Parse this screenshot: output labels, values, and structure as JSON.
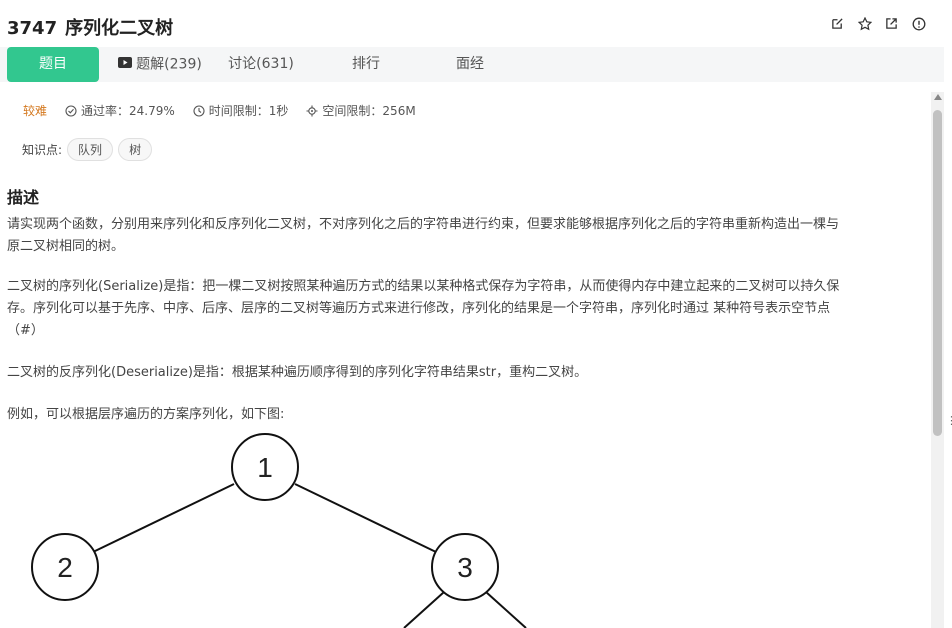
{
  "problem": {
    "number": "3747",
    "title": "序列化二叉树"
  },
  "header_icons": [
    "edit-icon",
    "star-icon",
    "external-link-icon",
    "info-icon"
  ],
  "tabs": [
    {
      "label": "题目",
      "active": true
    },
    {
      "label": "题解(239)",
      "icon": "video-icon"
    },
    {
      "label": "讨论(631)"
    },
    {
      "label": "排行"
    },
    {
      "label": "面经"
    }
  ],
  "meta": {
    "difficulty": "较难",
    "pass_rate": "通过率：24.79%",
    "time_limit": "时间限制：1秒",
    "space_limit": "空间限制：256M"
  },
  "knowledge": {
    "label": "知识点:",
    "tags": [
      "队列",
      "树"
    ]
  },
  "description": {
    "heading": "描述",
    "p1_line1": "请实现两个函数，分别用来序列化和反序列化二叉树，不对序列化之后的字符串进行约束，但要求能够根据序列化之后的字符串重新构造出一棵与",
    "p1_line2": "原二叉树相同的树。",
    "p2_line1": "二叉树的序列化(Serialize)是指：把一棵二叉树按照某种遍历方式的结果以某种格式保存为字符串，从而使得内存中建立起来的二叉树可以持久保",
    "p2_line2": "存。序列化可以基于先序、中序、后序、层序的二叉树等遍历方式来进行修改，序列化的结果是一个字符串，序列化时通过 某种符号表示空节点",
    "p2_line3": "（#）",
    "p3": "二叉树的反序列化(Deserialize)是指：根据某种遍历顺序得到的序列化字符串结果str，重构二叉树。",
    "p4": "例如，可以根据层序遍历的方案序列化，如下图:"
  },
  "tree_nodes": [
    "1",
    "2",
    "3"
  ],
  "colors": {
    "accent": "#32c78f",
    "difficulty": "#d4781f",
    "tab_bg": "#f5f6f7"
  }
}
